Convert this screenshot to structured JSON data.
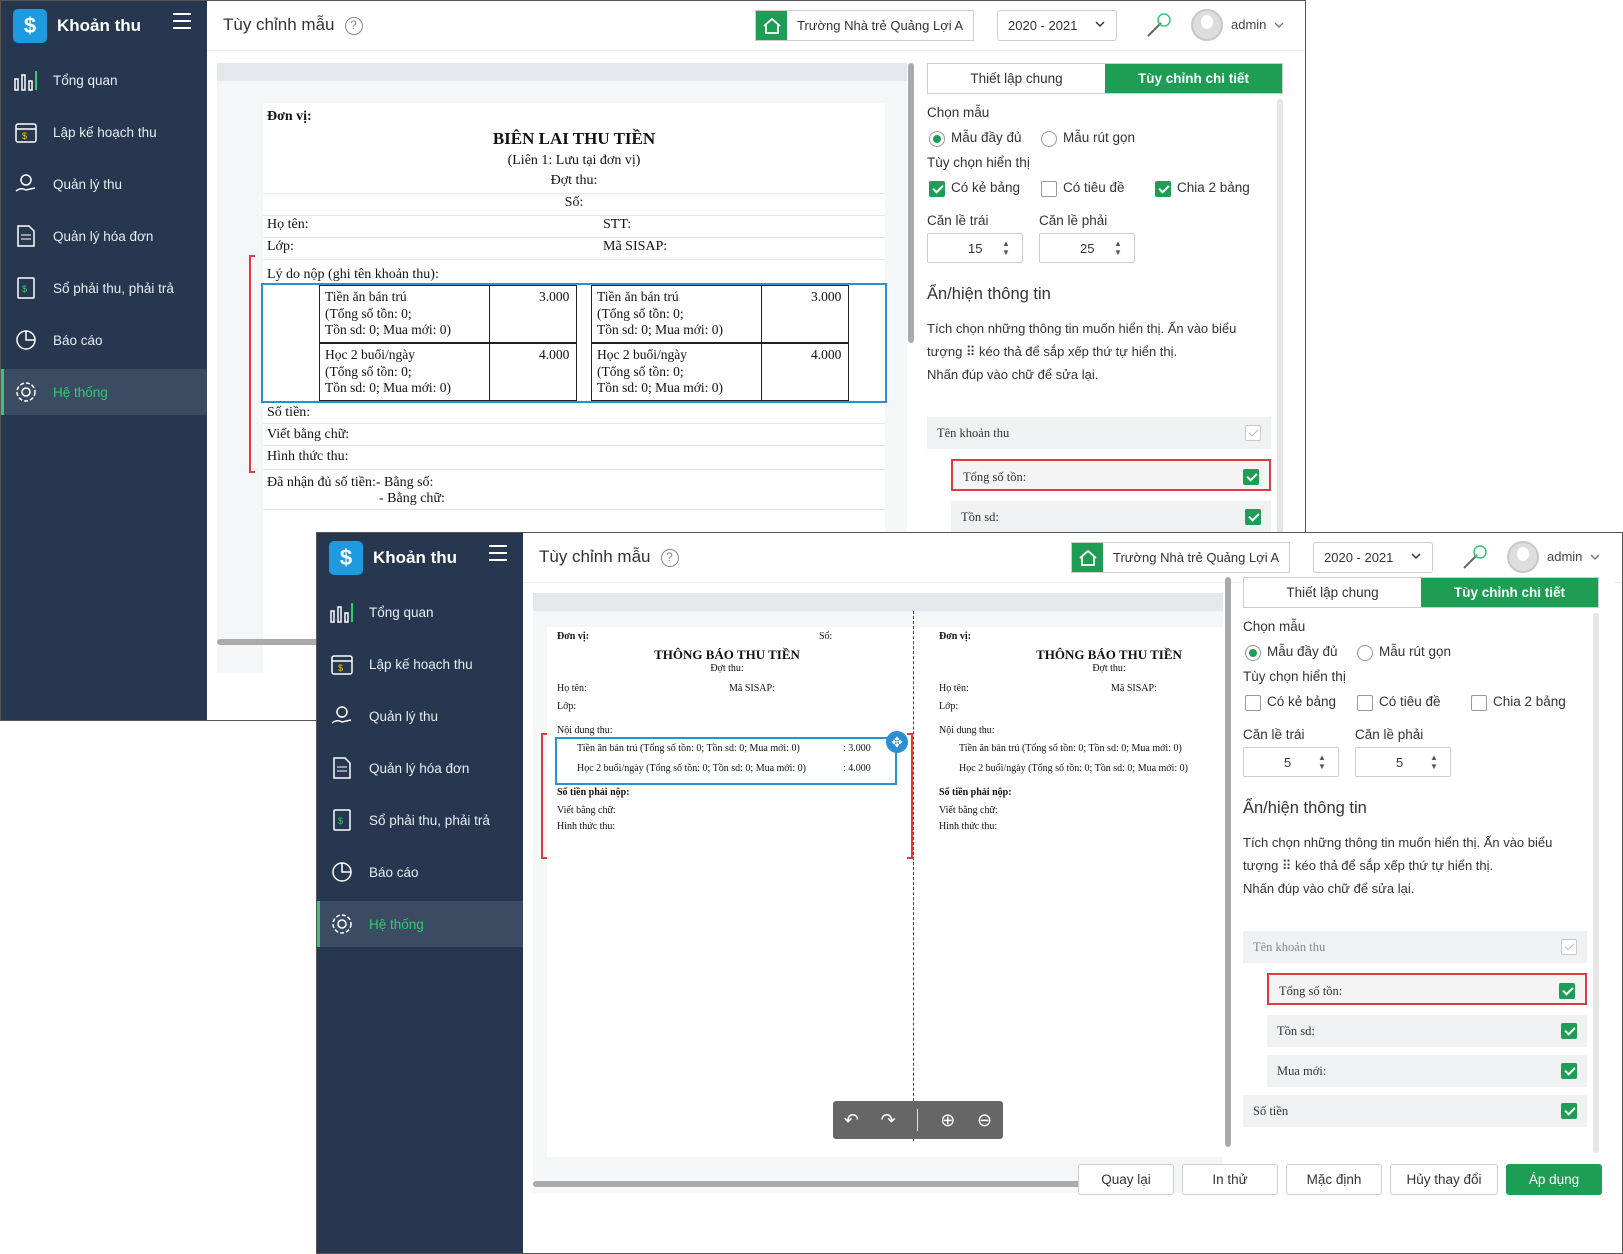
{
  "app": {
    "name": "Khoản thu"
  },
  "nav": [
    "Tổng quan",
    "Lập kế hoạch thu",
    "Quản lý thu",
    "Quản lý hóa đơn",
    "Sổ phải thu, phải trả",
    "Báo cáo",
    "Hệ thống"
  ],
  "header": {
    "title": "Tùy chỉnh mẫu",
    "school": "Trường Nhà trẻ Quảng Lợi A",
    "year": "2020 - 2021",
    "user": "admin"
  },
  "tabs": {
    "general": "Thiết lập chung",
    "detail": "Tùy chỉnh chi tiết"
  },
  "panel": {
    "choose_template": "Chọn mẫu",
    "full": "Mẫu đầy đủ",
    "compact": "Mẫu rút gọn",
    "display_options": "Tùy chọn hiển thị",
    "ruled": "Có kẻ bảng",
    "has_title": "Có tiêu đề",
    "split": "Chia 2 bảng",
    "margin_left": "Căn lề trái",
    "margin_right": "Căn lề phải",
    "section": "Ẩn/hiện thông tin",
    "desc1": "Tích chọn những thông tin muốn hiển thị. Ấn vào biểu",
    "desc2": "tượng ⠿ kéo thả để sắp xếp thứ tự hiển thị.",
    "desc3": "Nhấn đúp vào chữ để sửa lại."
  },
  "window1": {
    "margin_left": "15",
    "margin_right": "25",
    "ruled": true,
    "has_title": false,
    "split": true,
    "fields": [
      "Tên khoản thu",
      "Tổng số tồn:",
      "Tồn sd:"
    ],
    "receipt": {
      "don_vi": "Đơn vị:",
      "title": "BIÊN LAI THU TIỀN",
      "copy": "(Liên 1: Lưu tại đơn vị)",
      "dot_thu": "Đợt thu:",
      "so": "Số:",
      "ho_ten": "Họ tên:",
      "stt": "STT:",
      "lop": "Lớp:",
      "ma_sisap": "Mã SISAP:",
      "ly_do": "Lý do nộp (ghi tên khoản thu):",
      "items": [
        {
          "name": "Tiền ăn bán trú",
          "l2": "(Tổng số tồn: 0;",
          "l3": "Tồn sd: 0;  Mua mới: 0)",
          "amount": "3.000"
        },
        {
          "name": "Học 2 buổi/ngày",
          "l2": "(Tổng số tồn: 0;",
          "l3": "Tồn sd: 0;  Mua mới: 0)",
          "amount": "4.000"
        }
      ],
      "so_tien": "Số tiền:",
      "viet_bang_chu": "Viết bằng chữ:",
      "hinh_thuc": "Hình thức thu:",
      "da_nhan": "Đã nhận đủ số tiền:- Bằng số:",
      "bang_chu": "- Bằng chữ:"
    }
  },
  "window2": {
    "margin_left": "5",
    "margin_right": "5",
    "ruled": false,
    "has_title": false,
    "split": false,
    "fields": [
      "Tên khoản thu",
      "Tổng số tồn:",
      "Tồn sd:",
      "Mua mới:",
      "Số tiền"
    ],
    "notice": {
      "don_vi": "Đơn vị:",
      "so": "Số:",
      "title": "THÔNG BÁO THU TIỀN",
      "dot_thu": "Đợt thu:",
      "ho_ten": "Họ tên:",
      "ma_sisap": "Mã SISAP:",
      "lop": "Lớp:",
      "noi_dung": "Nội dung thu:",
      "line1": "Tiền ăn bán trú (Tổng số tồn: 0;    Tồn sd: 0;    Mua mới: 0)",
      "line1_amt": ": 3.000",
      "line2": "Học 2 buổi/ngày (Tổng số tồn: 0;    Tồn sd: 0;    Mua mới: 0)",
      "line2_amt": ": 4.000",
      "line1_r": "Tiền ăn bán trú (Tổng số tồn: 0;    Tồn sd: 0;    Mua mới: 0)",
      "line2_r": "Học 2 buổi/ngày (Tổng số tồn: 0;    Tồn sd: 0;    Mua mới: 0)",
      "so_tien_phai_nop": "Số tiền phải nộp:",
      "viet_bang_chu": "Viết bằng chữ:",
      "hinh_thuc": "Hình thức thu:"
    },
    "buttons": [
      "Quay lại",
      "In thử",
      "Mặc định",
      "Hủy thay đổi",
      "Áp dụng"
    ]
  },
  "colors": {
    "sidebar": "#26374f",
    "accent": "#1e9e55",
    "active_nav": "#2ecc71",
    "highlight": "#e03c3c",
    "selection": "#2b8fd6"
  },
  "icons": [
    "dollar-logo-icon",
    "menu-icon",
    "bar-chart-icon",
    "calendar-icon",
    "hand-coin-icon",
    "document-icon",
    "ledger-icon",
    "pie-chart-icon",
    "gear-icon",
    "home-icon",
    "chevron-down-icon",
    "magic-wand-icon",
    "user-avatar-icon",
    "help-icon",
    "move-icon",
    "undo-icon",
    "redo-icon",
    "zoom-in-icon",
    "zoom-out-icon"
  ]
}
